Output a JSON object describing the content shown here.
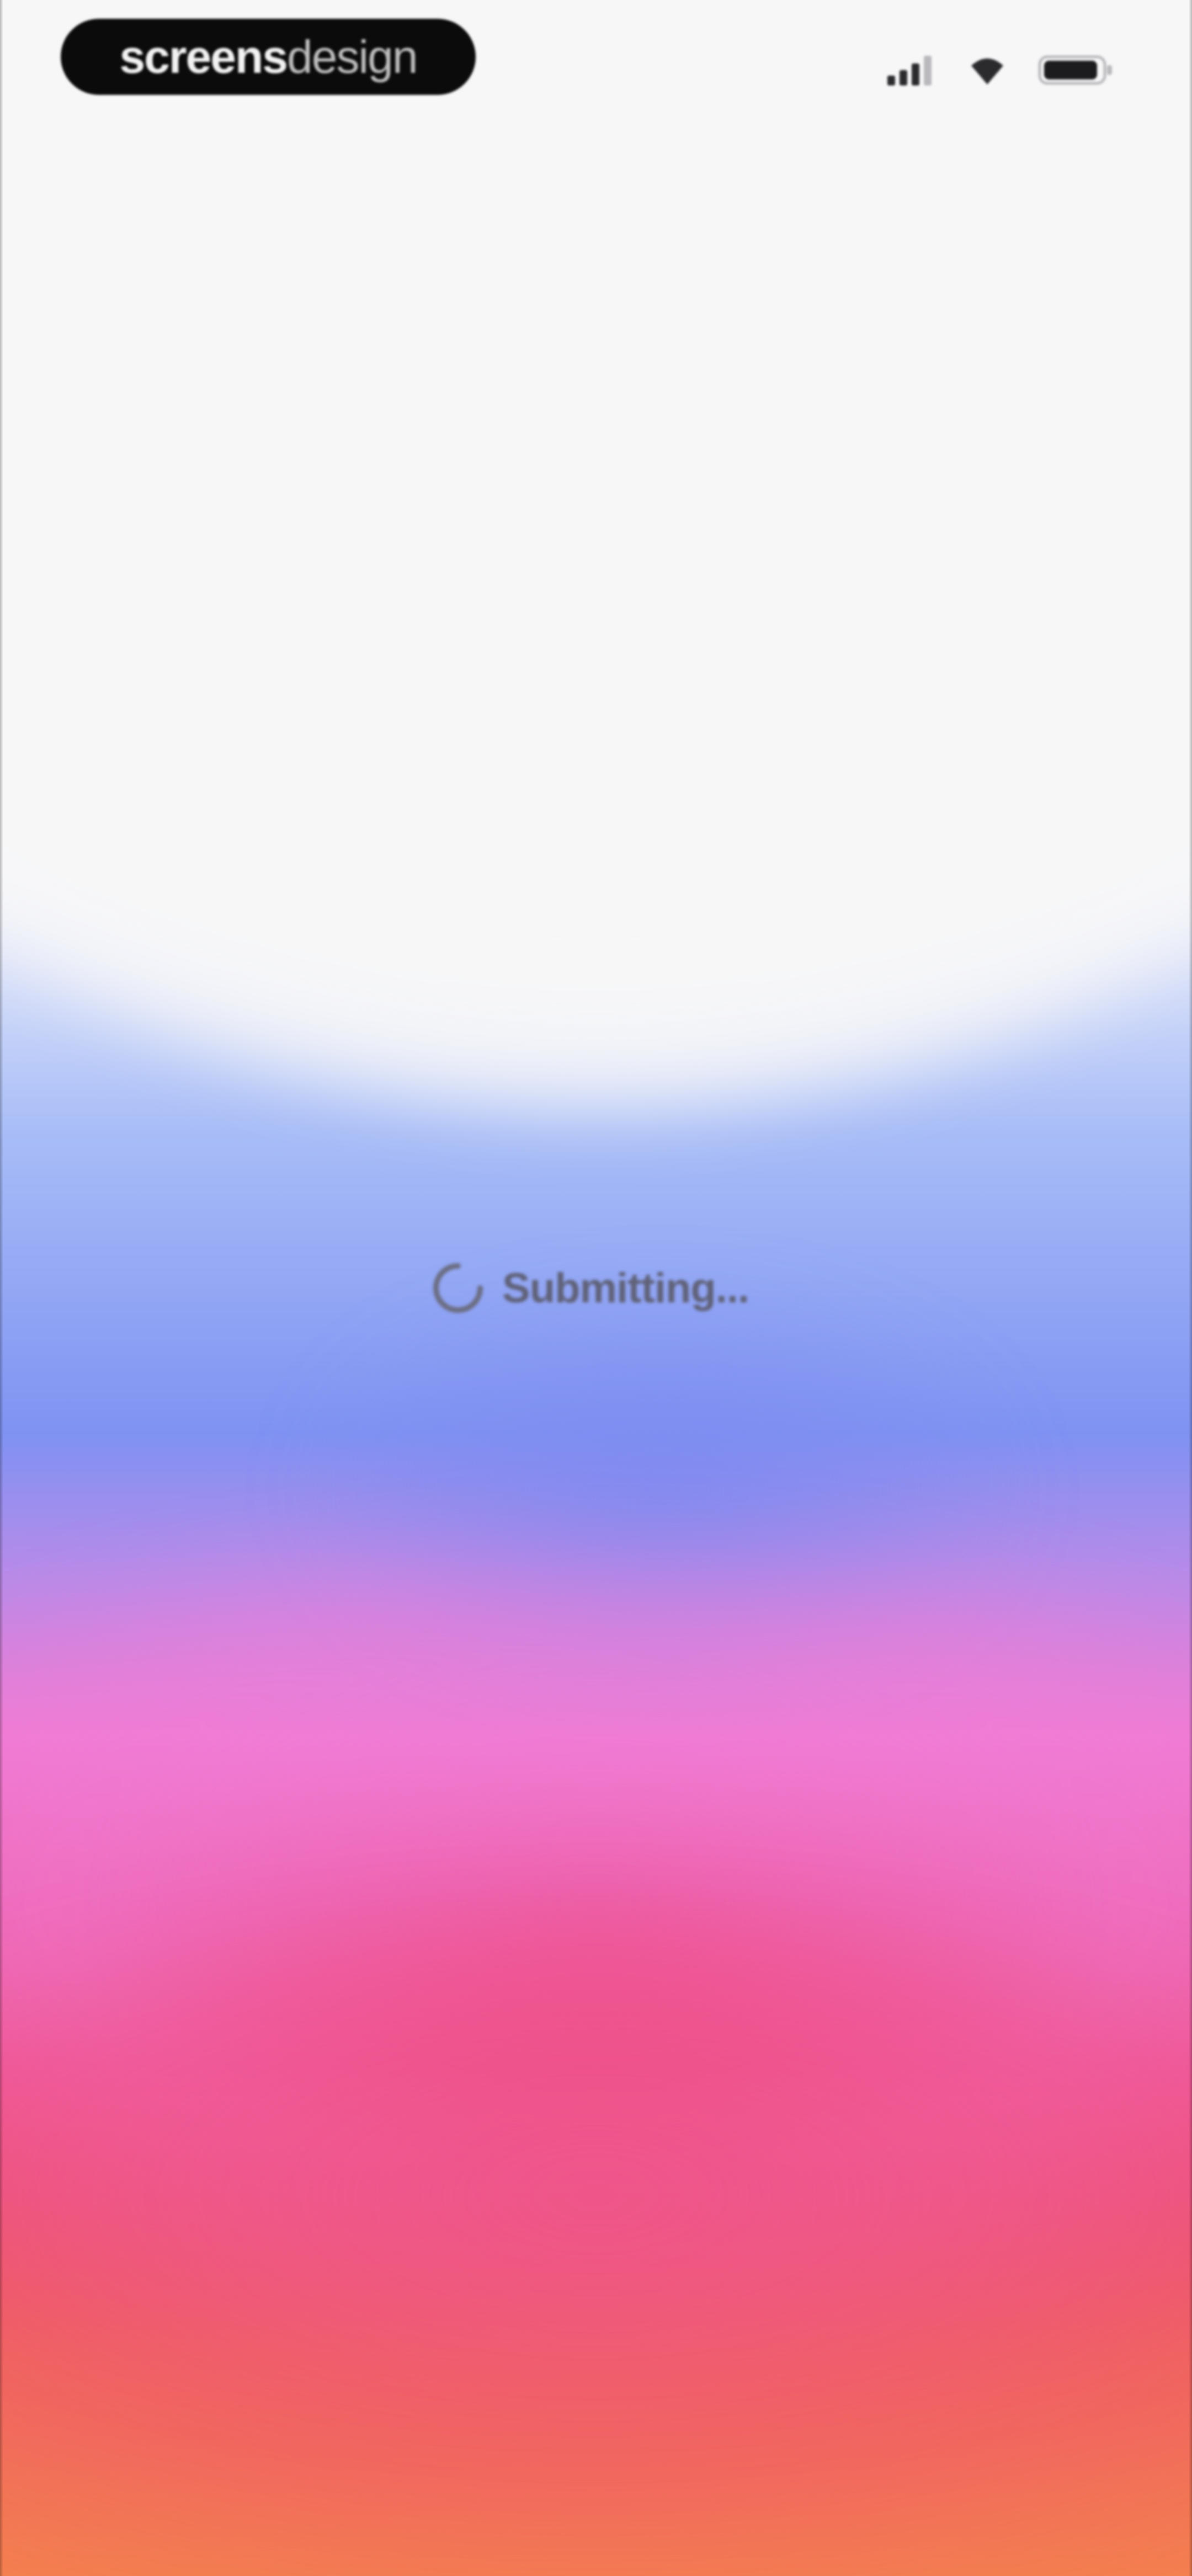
{
  "status_bar": {
    "brand": {
      "strong": "screens",
      "light": "design"
    },
    "icons": [
      "cellular-signal-icon",
      "wifi-icon",
      "battery-icon"
    ]
  },
  "loader": {
    "text": "Submitting...",
    "icon": "spinner-icon"
  },
  "colors": {
    "background_top": "#f7f7f8",
    "blue": "#7f92f2",
    "pink": "#f07bd3",
    "red": "#ef4d82",
    "orange": "#f47f4f",
    "text": "#5f6177",
    "brand_pill": "#0b0b0c"
  }
}
